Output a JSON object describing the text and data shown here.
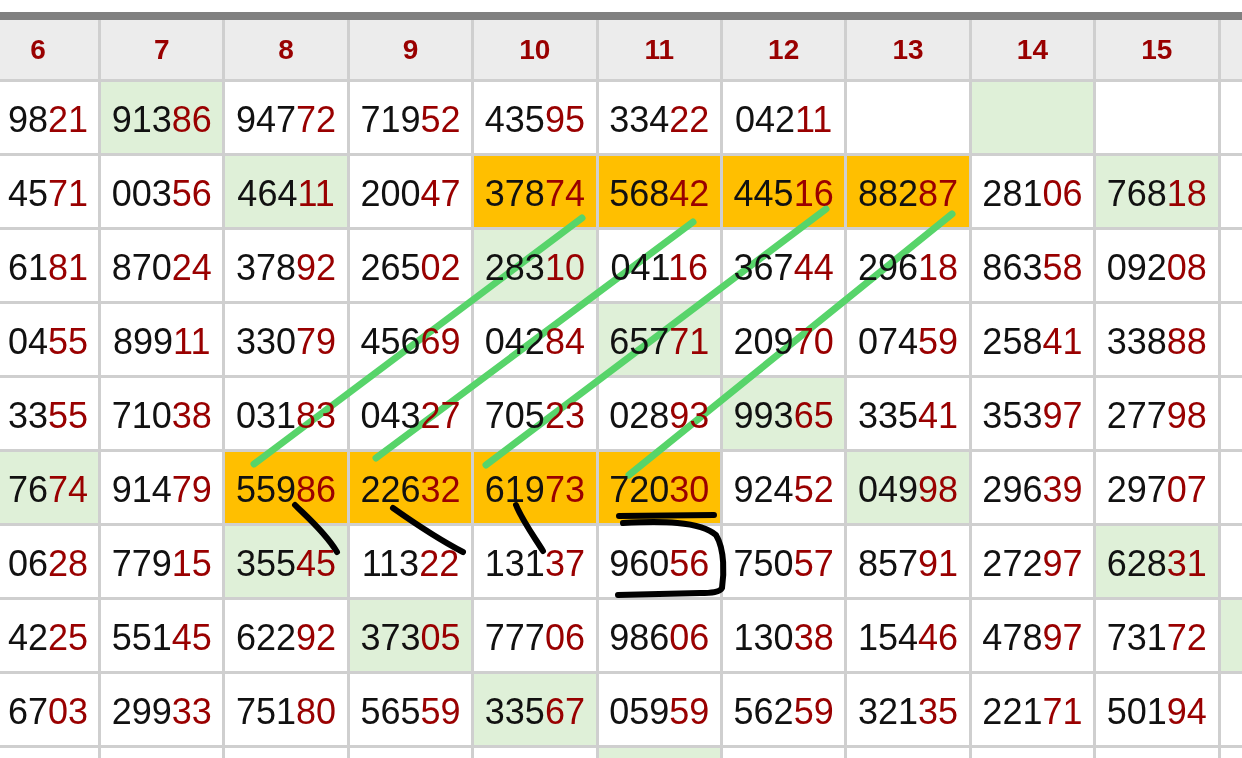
{
  "table": {
    "columns": [
      "6",
      "7",
      "8",
      "9",
      "10",
      "11",
      "12",
      "13",
      "14",
      "15"
    ],
    "rows": [
      {
        "cells": [
          {
            "text": "9821",
            "color": "#ffffff"
          },
          {
            "text": "91386",
            "color": "#dff0d8"
          },
          {
            "text": "94772",
            "color": "#ffffff"
          },
          {
            "text": "71952",
            "color": "#ffffff"
          },
          {
            "text": "43595",
            "color": "#ffffff"
          },
          {
            "text": "33422",
            "color": "#ffffff"
          },
          {
            "text": "04211",
            "color": "#ffffff"
          },
          {
            "color": "#ffffff"
          },
          {
            "color": "#dff0d8"
          },
          {
            "color": "#ffffff"
          },
          {
            "color": "#ffffff"
          }
        ]
      },
      {
        "cells": [
          {
            "text": "4571",
            "color": "#ffffff"
          },
          {
            "text": "00356",
            "color": "#ffffff"
          },
          {
            "text": "46411",
            "color": "#dff0d8"
          },
          {
            "text": "20047",
            "color": "#ffffff"
          },
          {
            "text": "37874",
            "color": "#ffbf00"
          },
          {
            "text": "56842",
            "color": "#ffbf00"
          },
          {
            "text": "44516",
            "color": "#ffbf00"
          },
          {
            "text": "88287",
            "color": "#ffbf00"
          },
          {
            "text": "28106",
            "color": "#ffffff"
          },
          {
            "text": "76818",
            "color": "#dff0d8"
          },
          {
            "color": "#ffffff"
          }
        ]
      },
      {
        "cells": [
          {
            "text": "6181",
            "color": "#ffffff"
          },
          {
            "text": "87024",
            "color": "#ffffff"
          },
          {
            "text": "37892",
            "color": "#ffffff"
          },
          {
            "text": "26502",
            "color": "#ffffff"
          },
          {
            "text": "28310",
            "color": "#dff0d8"
          },
          {
            "text": "04116",
            "color": "#ffffff"
          },
          {
            "text": "36744",
            "color": "#ffffff"
          },
          {
            "text": "29618",
            "color": "#ffffff"
          },
          {
            "text": "86358",
            "color": "#ffffff"
          },
          {
            "text": "09208",
            "color": "#ffffff"
          },
          {
            "color": "#ffffff"
          }
        ]
      },
      {
        "cells": [
          {
            "text": "0455",
            "color": "#ffffff"
          },
          {
            "text": "89911",
            "color": "#ffffff"
          },
          {
            "text": "33079",
            "color": "#ffffff"
          },
          {
            "text": "45669",
            "color": "#ffffff"
          },
          {
            "text": "04284",
            "color": "#ffffff"
          },
          {
            "text": "65771",
            "color": "#dff0d8"
          },
          {
            "text": "20970",
            "color": "#ffffff"
          },
          {
            "text": "07459",
            "color": "#ffffff"
          },
          {
            "text": "25841",
            "color": "#ffffff"
          },
          {
            "text": "33888",
            "color": "#ffffff"
          },
          {
            "color": "#ffffff"
          }
        ]
      },
      {
        "cells": [
          {
            "text": "3355",
            "color": "#ffffff"
          },
          {
            "text": "71038",
            "color": "#ffffff"
          },
          {
            "text": "03183",
            "color": "#ffffff"
          },
          {
            "text": "04327",
            "color": "#ffffff"
          },
          {
            "text": "70523",
            "color": "#ffffff"
          },
          {
            "text": "02893",
            "color": "#ffffff"
          },
          {
            "text": "99365",
            "color": "#dff0d8"
          },
          {
            "text": "33541",
            "color": "#ffffff"
          },
          {
            "text": "35397",
            "color": "#ffffff"
          },
          {
            "text": "27798",
            "color": "#ffffff"
          },
          {
            "color": "#ffffff"
          }
        ]
      },
      {
        "cells": [
          {
            "text": "7674",
            "color": "#dff0d8"
          },
          {
            "text": "91479",
            "color": "#ffffff"
          },
          {
            "text": "55986",
            "color": "#ffbf00"
          },
          {
            "text": "22632",
            "color": "#ffbf00"
          },
          {
            "text": "61973",
            "color": "#ffbf00"
          },
          {
            "text": "72030",
            "color": "#ffbf00"
          },
          {
            "text": "92452",
            "color": "#ffffff"
          },
          {
            "text": "04998",
            "color": "#dff0d8"
          },
          {
            "text": "29639",
            "color": "#ffffff"
          },
          {
            "text": "29707",
            "color": "#ffffff"
          },
          {
            "color": "#ffffff"
          }
        ]
      },
      {
        "cells": [
          {
            "text": "0628",
            "color": "#ffffff"
          },
          {
            "text": "77915",
            "color": "#ffffff"
          },
          {
            "text": "35545",
            "color": "#dff0d8"
          },
          {
            "text": "11322",
            "color": "#ffffff"
          },
          {
            "text": "13137",
            "color": "#ffffff"
          },
          {
            "text": "96056",
            "color": "#ffffff"
          },
          {
            "text": "75057",
            "color": "#ffffff"
          },
          {
            "text": "85791",
            "color": "#ffffff"
          },
          {
            "text": "27297",
            "color": "#ffffff"
          },
          {
            "text": "62831",
            "color": "#dff0d8"
          },
          {
            "color": "#ffffff"
          }
        ]
      },
      {
        "cells": [
          {
            "text": "4225",
            "color": "#ffffff"
          },
          {
            "text": "55145",
            "color": "#ffffff"
          },
          {
            "text": "62292",
            "color": "#ffffff"
          },
          {
            "text": "37305",
            "color": "#dff0d8"
          },
          {
            "text": "77706",
            "color": "#ffffff"
          },
          {
            "text": "98606",
            "color": "#ffffff"
          },
          {
            "text": "13038",
            "color": "#ffffff"
          },
          {
            "text": "15446",
            "color": "#ffffff"
          },
          {
            "text": "47897",
            "color": "#ffffff"
          },
          {
            "text": "73172",
            "color": "#ffffff"
          },
          {
            "color": "#dff0d8"
          }
        ]
      },
      {
        "cells": [
          {
            "text": "6703",
            "color": "#ffffff"
          },
          {
            "text": "29933",
            "color": "#ffffff"
          },
          {
            "text": "75180",
            "color": "#ffffff"
          },
          {
            "text": "56559",
            "color": "#ffffff"
          },
          {
            "text": "33567",
            "color": "#dff0d8"
          },
          {
            "text": "05959",
            "color": "#ffffff"
          },
          {
            "text": "56259",
            "color": "#ffffff"
          },
          {
            "text": "32135",
            "color": "#ffffff"
          },
          {
            "text": "22171",
            "color": "#ffffff"
          },
          {
            "text": "50194",
            "color": "#ffffff"
          },
          {
            "color": "#ffffff"
          }
        ]
      },
      {
        "cells": [
          {
            "color": "#ffffff"
          },
          {
            "color": "#ffffff"
          },
          {
            "color": "#ffffff"
          },
          {
            "color": "#ffffff"
          },
          {
            "color": "#ffffff"
          },
          {
            "color": "#dff0d8"
          },
          {
            "color": "#ffffff"
          },
          {
            "color": "#ffffff"
          },
          {
            "color": "#ffffff"
          },
          {
            "color": "#ffffff"
          },
          {
            "color": "#ffffff"
          }
        ]
      }
    ]
  }
}
